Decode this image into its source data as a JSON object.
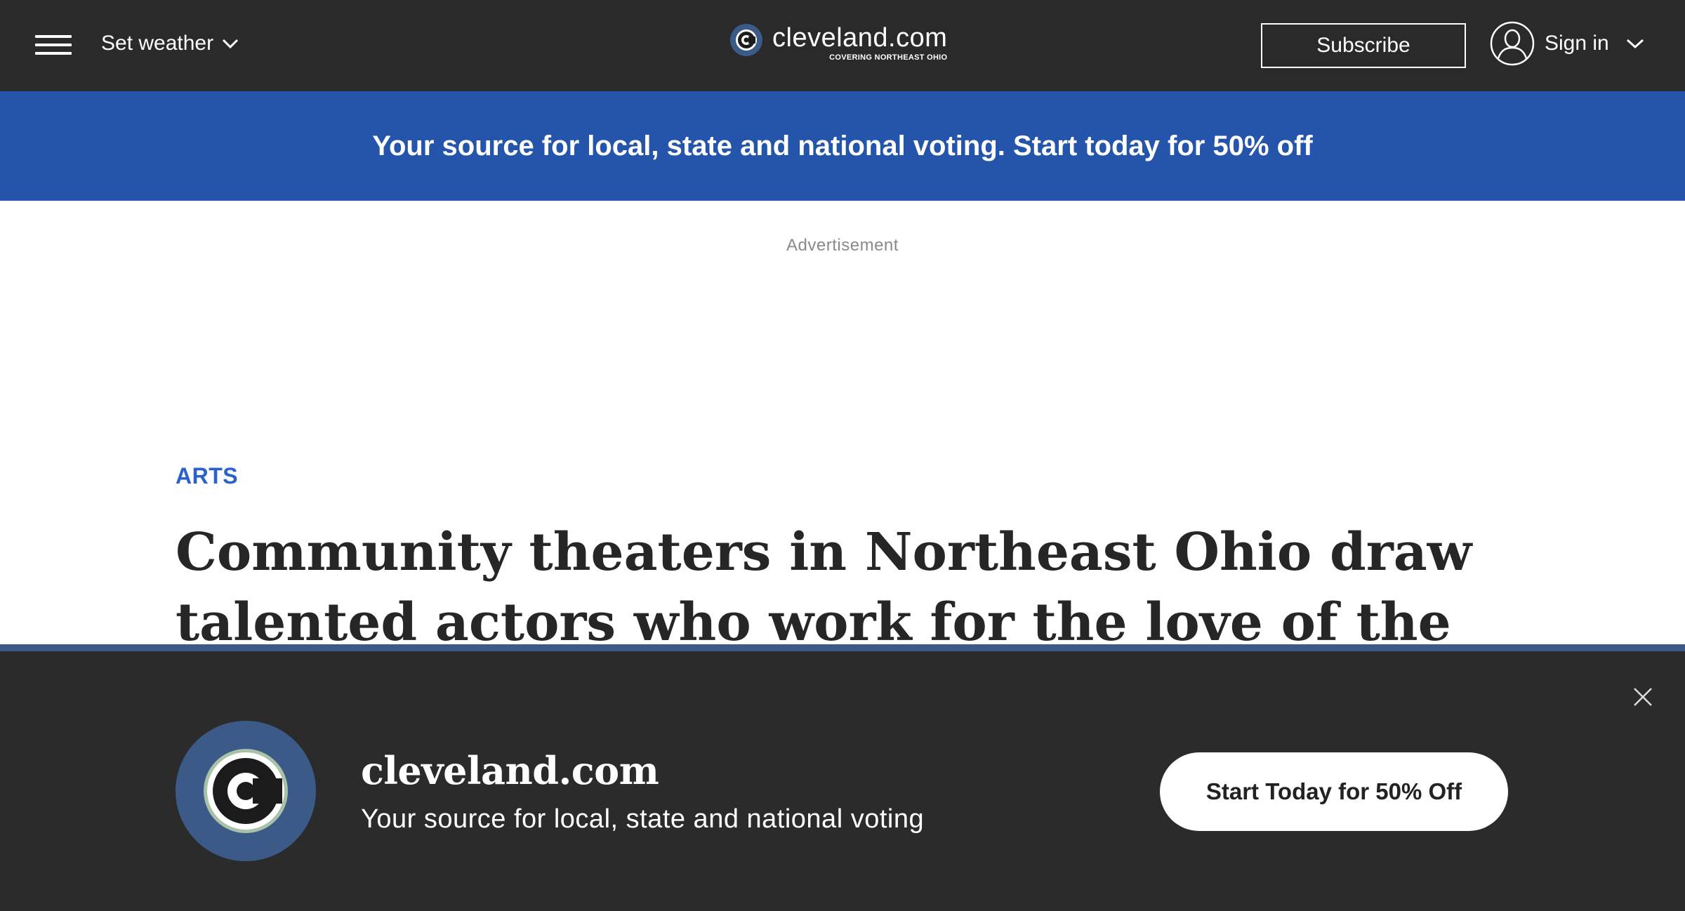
{
  "header": {
    "weather_label": "Set weather",
    "logo_name": "cleveland.com",
    "logo_tagline": "COVERING NORTHEAST OHIO",
    "subscribe_label": "Subscribe",
    "signin_label": "Sign in",
    "icons": [
      "menu-icon",
      "chevron-down-icon",
      "cleveland-logo",
      "user-icon"
    ]
  },
  "promo": {
    "text": "Your source for local, state and national voting. Start today for 50% off"
  },
  "ad": {
    "label": "Advertisement"
  },
  "article": {
    "section": "ARTS",
    "headline": "Community theaters in Northeast Ohio draw talented actors who work for the love of the stage"
  },
  "sticky": {
    "brand": "cleveland.com",
    "tagline": "Your source for local, state and national voting",
    "cta_label": "Start Today for 50% Off"
  },
  "colors": {
    "header_bg": "#2a2a2a",
    "promo_bg": "#2455ab",
    "section_accent": "#2962c9",
    "sticky_bg": "#2b2b2b",
    "logo_ring": "#3c5a88"
  }
}
